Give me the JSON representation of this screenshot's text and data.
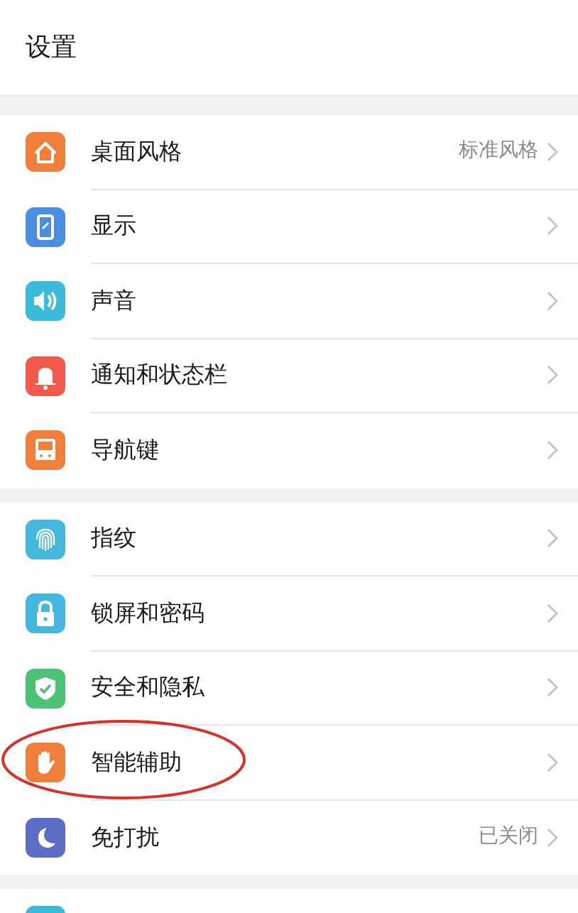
{
  "header": {
    "title": "设置"
  },
  "groups": [
    {
      "items": [
        {
          "label": "桌面风格",
          "value": "标准风格",
          "color": "#f07f3c",
          "circled": false
        },
        {
          "label": "显示",
          "color": "#4a8fdf",
          "circled": false
        },
        {
          "label": "声音",
          "color": "#3bbbd8",
          "circled": false
        },
        {
          "label": "通知和状态栏",
          "color": "#f25a4e",
          "circled": false
        },
        {
          "label": "导航键",
          "color": "#f07f3c",
          "circled": false
        }
      ]
    },
    {
      "items": [
        {
          "label": "指纹",
          "color": "#43b8dc",
          "circled": false
        },
        {
          "label": "锁屏和密码",
          "color": "#43b8dc",
          "circled": false
        },
        {
          "label": "安全和隐私",
          "color": "#4cc276",
          "circled": false
        },
        {
          "label": "智能辅助",
          "color": "#f07f3c",
          "circled": true
        },
        {
          "label": "免打扰",
          "value": "已关闭",
          "color": "#5d6cc4",
          "circled": false
        }
      ]
    },
    {
      "items": [
        {
          "color": "#3bbbd8",
          "circled": false
        }
      ]
    }
  ]
}
